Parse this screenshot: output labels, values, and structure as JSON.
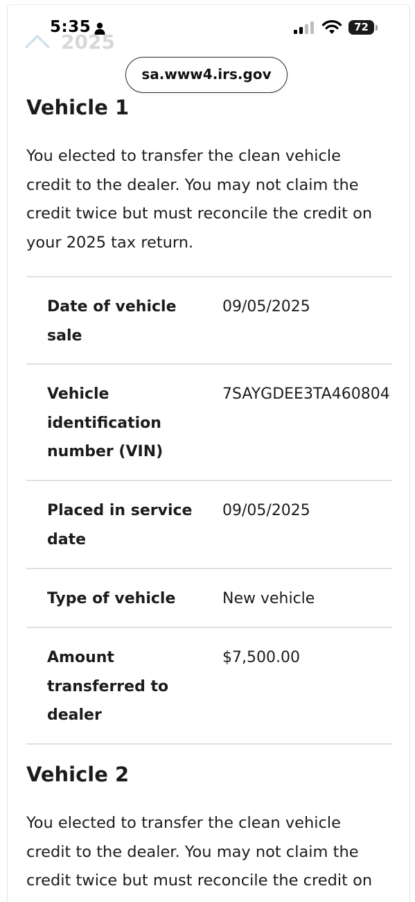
{
  "status_bar": {
    "time": "5:35",
    "battery_level": "72",
    "icons": [
      "person-icon",
      "signal-icon",
      "wifi-icon",
      "battery-icon"
    ]
  },
  "browser": {
    "url": "sa.www4.irs.gov"
  },
  "faded_header": {
    "year": "2025",
    "icon": "chevron-up-icon"
  },
  "vehicle1": {
    "heading": "Vehicle 1",
    "intro": "You elected to transfer the clean vehicle credit to the dealer. You may not claim the credit twice but must reconcile the credit on your 2025 tax return.",
    "rows": [
      {
        "label": "Date of vehicle sale",
        "value": "09/05/2025"
      },
      {
        "label": "Vehicle identification number (VIN)",
        "value": "7SAYGDEE3TA460804"
      },
      {
        "label": "Placed in service date",
        "value": "09/05/2025"
      },
      {
        "label": "Type of vehicle",
        "value": "New vehicle"
      },
      {
        "label": "Amount transferred to dealer",
        "value": "$7,500.00"
      }
    ]
  },
  "vehicle2": {
    "heading": "Vehicle 2",
    "intro": "You elected to transfer the clean vehicle credit to the dealer. You may not claim the credit twice but must reconcile the credit on"
  },
  "colors": {
    "text": "#1b1b1b",
    "divider": "#dfe1e2",
    "faded": "#d7d7d7"
  }
}
